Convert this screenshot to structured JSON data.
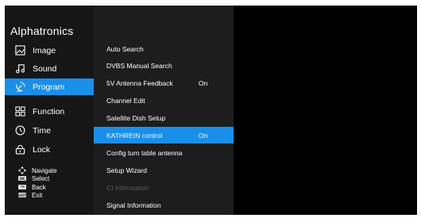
{
  "brand": "Alphatronics",
  "colors": {
    "accent": "#1a8fea",
    "background": "#000000",
    "disabled_text": "#5a5a5a"
  },
  "nav": {
    "items": [
      {
        "label": "Image",
        "icon": "image-icon"
      },
      {
        "label": "Sound",
        "icon": "music-note-icon"
      },
      {
        "label": "Program",
        "icon": "satellite-dish-icon",
        "active": true
      },
      {
        "label": "Function",
        "icon": "grid-icon"
      },
      {
        "label": "Time",
        "icon": "clock-icon"
      },
      {
        "label": "Lock",
        "icon": "lock-icon"
      }
    ]
  },
  "hints": [
    {
      "label": "Navigate",
      "icon": "dpad-icon"
    },
    {
      "label": "Select",
      "icon": "ok-key-icon",
      "key": "OK"
    },
    {
      "label": "Back",
      "icon": "back-key-icon",
      "key": ""
    },
    {
      "label": "Exit",
      "icon": "exit-key-icon",
      "key": "EXIT"
    }
  ],
  "menu": {
    "items": [
      {
        "label": "Auto Search",
        "value": ""
      },
      {
        "label": "DVBS Manual Search",
        "value": ""
      },
      {
        "label": "5V Antenna Feedback",
        "value": "On"
      },
      {
        "label": "Channel Edit",
        "value": ""
      },
      {
        "label": "Satellite Dish Setup",
        "value": ""
      },
      {
        "label": "KATHREIN control",
        "value": "On",
        "active": true
      },
      {
        "label": "Config turn table antenna",
        "value": ""
      },
      {
        "label": "Setup Wizard",
        "value": ""
      },
      {
        "label": "CI Information",
        "value": "",
        "disabled": true
      },
      {
        "label": "Signal Information",
        "value": ""
      }
    ]
  }
}
